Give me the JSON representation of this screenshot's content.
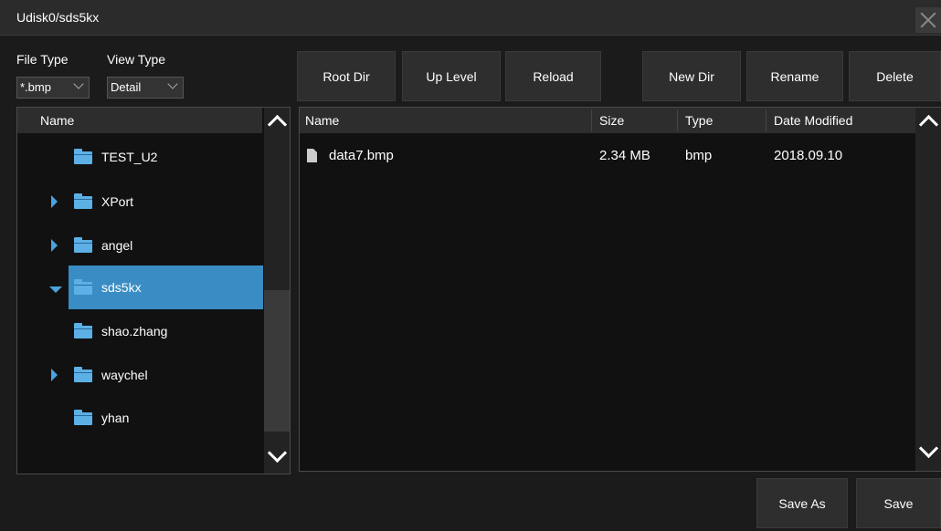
{
  "window": {
    "title": "Udisk0/sds5kx"
  },
  "filters": {
    "file_type_label": "File Type",
    "file_type_value": "*.bmp",
    "view_type_label": "View Type",
    "view_type_value": "Detail"
  },
  "toolbar": {
    "root_dir": "Root Dir",
    "up_level": "Up Level",
    "reload": "Reload",
    "new_dir": "New Dir",
    "rename": "Rename",
    "delete": "Delete"
  },
  "tree": {
    "header": "Name",
    "items": [
      {
        "label": "TEST_U2",
        "expander": "none",
        "selected": false
      },
      {
        "label": "XPort",
        "expander": "collapsed",
        "selected": false
      },
      {
        "label": "angel",
        "expander": "collapsed",
        "selected": false
      },
      {
        "label": "sds5kx",
        "expander": "expanded",
        "selected": true
      },
      {
        "label": "shao.zhang",
        "expander": "none",
        "selected": false
      },
      {
        "label": "waychel",
        "expander": "collapsed",
        "selected": false
      },
      {
        "label": "yhan",
        "expander": "none",
        "selected": false
      }
    ]
  },
  "files": {
    "columns": {
      "name": "Name",
      "size": "Size",
      "type": "Type",
      "date": "Date Modified"
    },
    "rows": [
      {
        "name": "data7.bmp",
        "size": "2.34 MB",
        "type": "bmp",
        "date": "2018.09.10"
      }
    ]
  },
  "footer": {
    "save_as": "Save As",
    "save": "Save"
  },
  "colors": {
    "accent": "#3a8dc4",
    "folder": "#5cb0e6",
    "background": "#1b1b1b"
  }
}
